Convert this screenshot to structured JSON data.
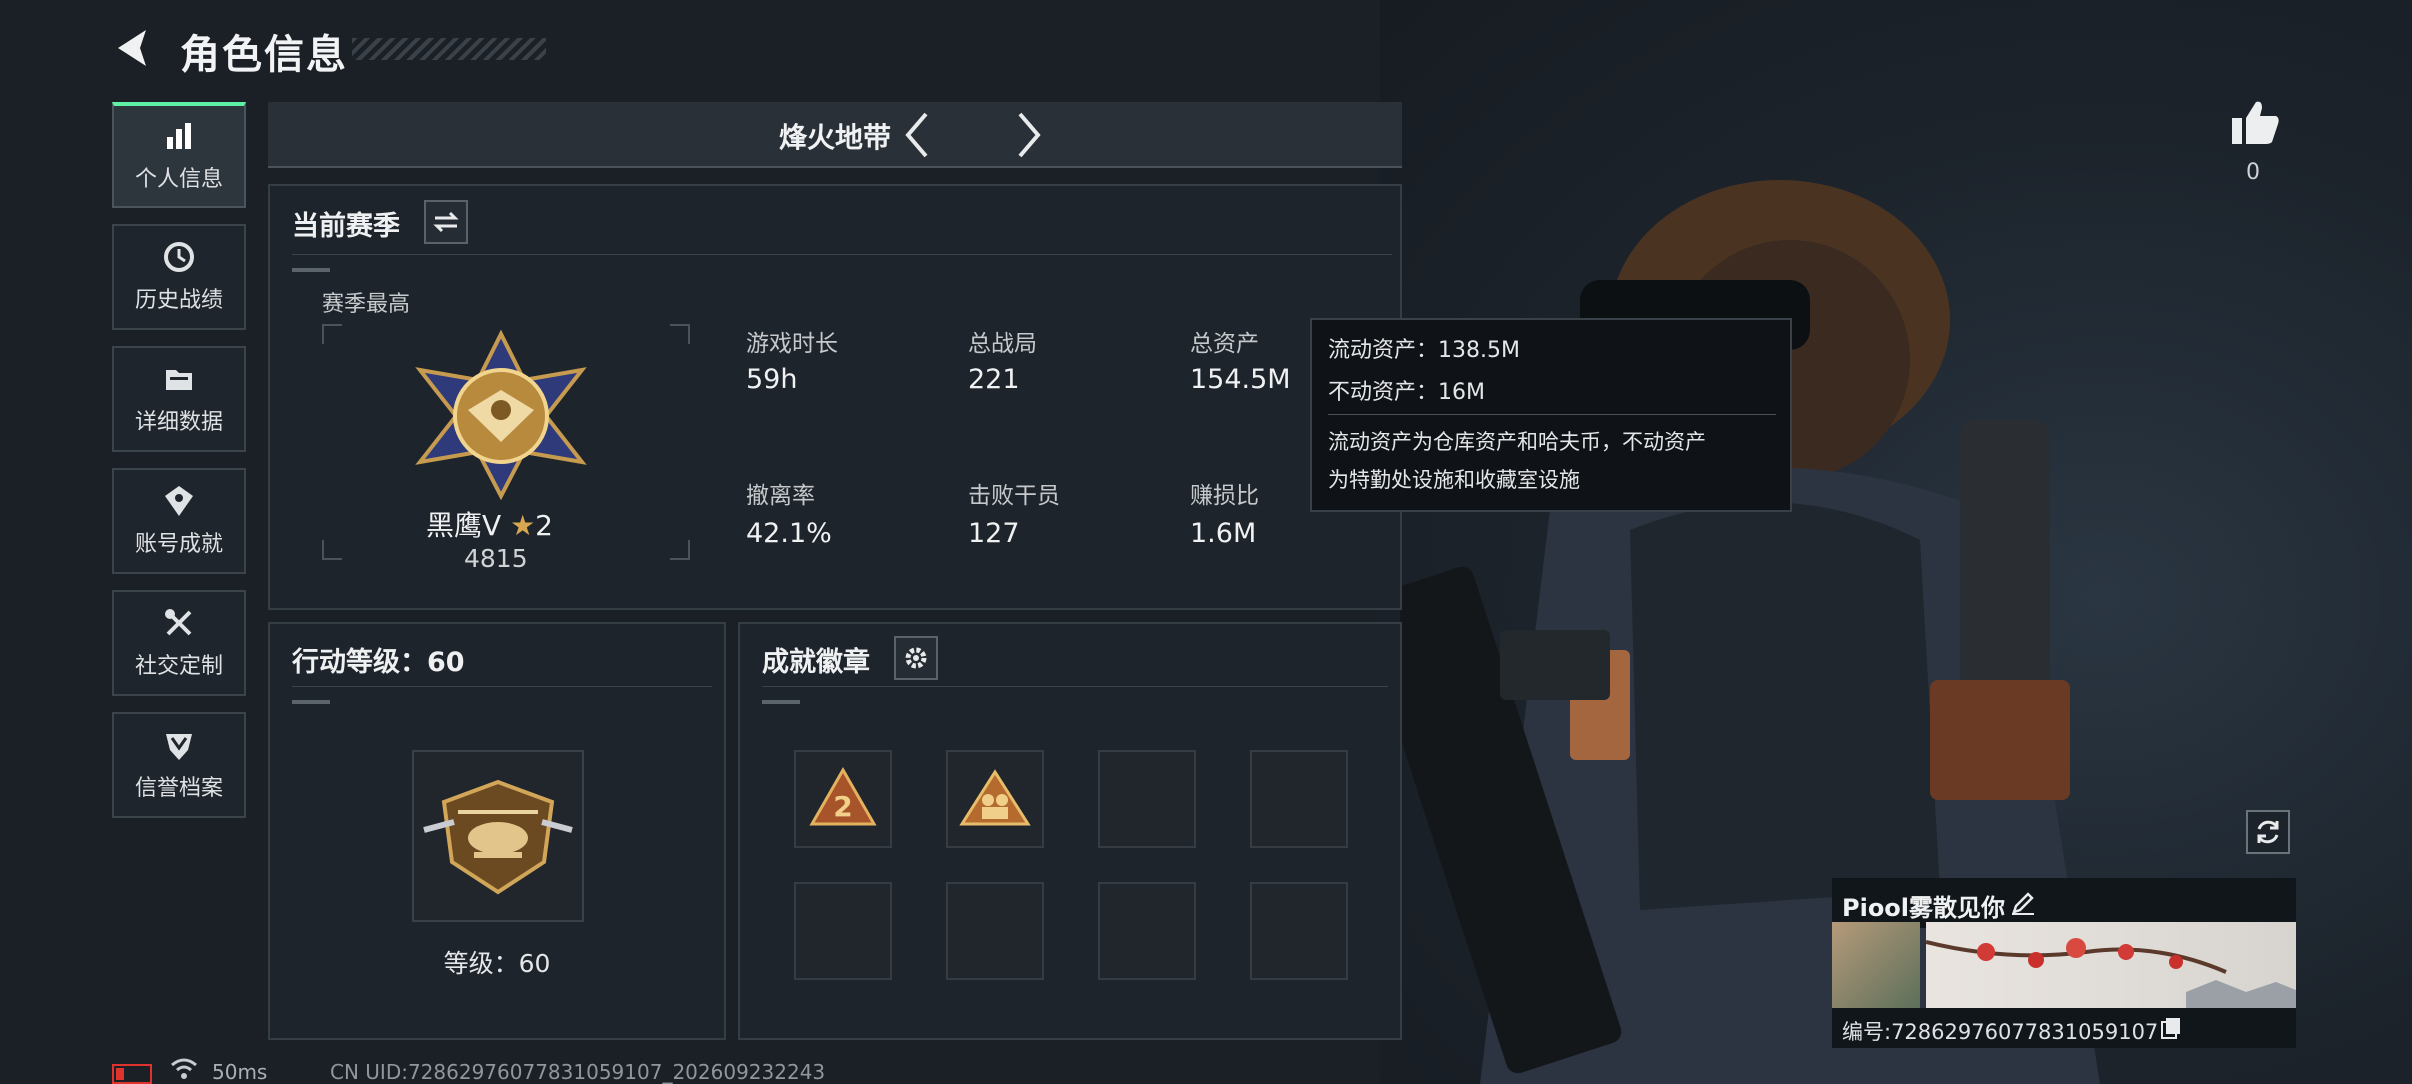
{
  "header": {
    "title": "角色信息"
  },
  "nav": {
    "items": [
      {
        "label": "个人信息",
        "icon": "bar-chart-icon",
        "active": true
      },
      {
        "label": "历史战绩",
        "icon": "clock-icon",
        "active": false
      },
      {
        "label": "详细数据",
        "icon": "folder-icon",
        "active": false
      },
      {
        "label": "账号成就",
        "icon": "achievement-icon",
        "active": false
      },
      {
        "label": "社交定制",
        "icon": "tools-icon",
        "active": false
      },
      {
        "label": "信誉档案",
        "icon": "shield-icon",
        "active": false
      }
    ]
  },
  "mode": {
    "name": "烽火地带"
  },
  "season": {
    "title": "当前赛季",
    "best_label": "赛季最高",
    "rank_name": "黑鹰Ⅴ",
    "rank_stars": "2",
    "rank_points": "4815",
    "stats": [
      {
        "label": "游戏时长",
        "value": "59h"
      },
      {
        "label": "总战局",
        "value": "221"
      },
      {
        "label": "总资产",
        "value": "154.5M"
      },
      {
        "label": "撤离率",
        "value": "42.1%"
      },
      {
        "label": "击败干员",
        "value": "127"
      },
      {
        "label": "赚损比",
        "value": "1.6M"
      }
    ]
  },
  "tooltip": {
    "liquid": "流动资产：138.5M",
    "fixed": "不动资产：16M",
    "desc_line1": "流动资产为仓库资产和哈夫币，不动资产",
    "desc_line2": "为特勤处设施和收藏室设施"
  },
  "action_level": {
    "title": "行动等级：60",
    "level_text": "等级：60"
  },
  "achievement": {
    "title": "成就徽章",
    "badges_filled": 2,
    "badges_total": 8
  },
  "likes": {
    "count": "0"
  },
  "profile": {
    "name": "Piool雾散见你",
    "id_text": "编号:7286297607783105910​7"
  },
  "footer": {
    "ping": "50ms",
    "uid": "CN UID:7286297607783105910​7_202609232243"
  },
  "colors": {
    "accent": "#5ff0a8",
    "battery": "#e0332e",
    "gold": "#d6a650"
  }
}
